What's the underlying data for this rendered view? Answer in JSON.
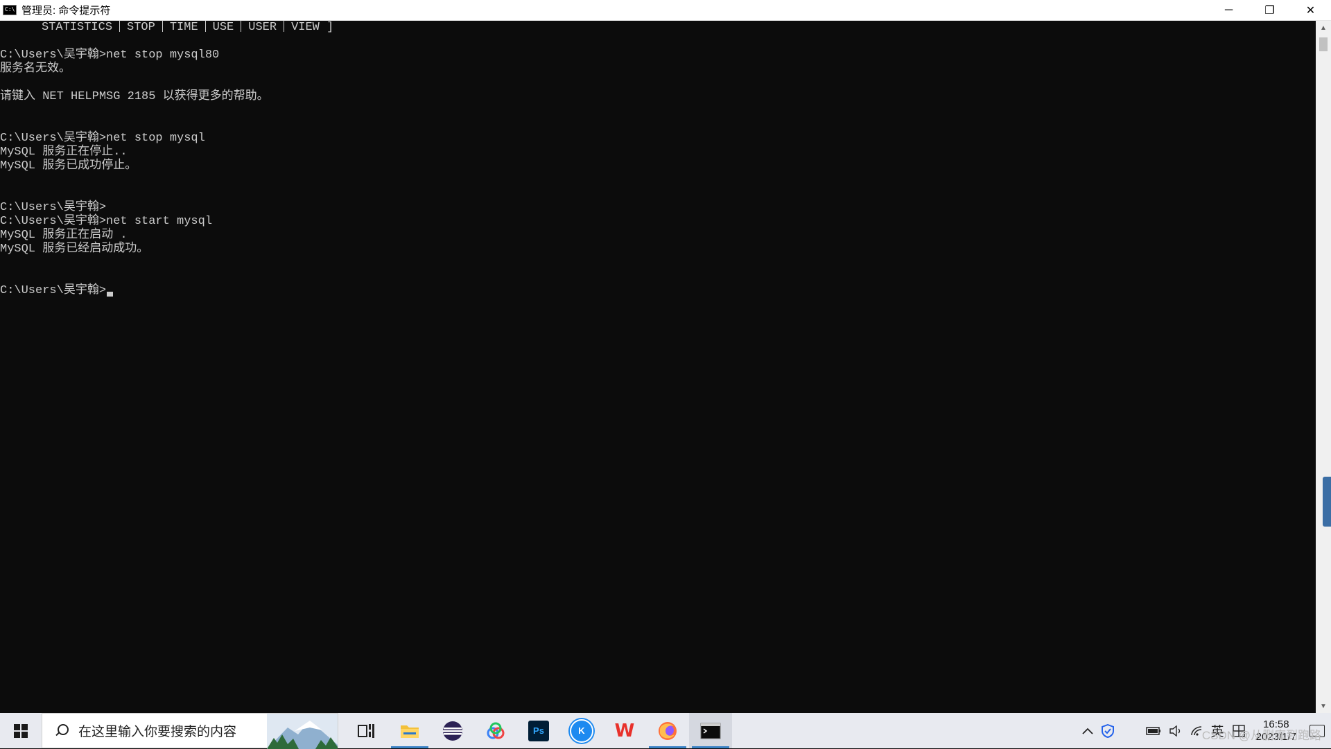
{
  "window": {
    "title": "管理员: 命令提示符",
    "controls": {
      "minimize": "─",
      "restore": "❐",
      "close": "✕"
    }
  },
  "console": {
    "header_items": [
      "STATISTICS",
      "STOP",
      "TIME",
      "USE",
      "USER",
      "VIEW ]"
    ],
    "lines": [
      "C:\\Users\\吴宇翰>net stop mysql80",
      "服务名无效。",
      "",
      "请键入 NET HELPMSG 2185 以获得更多的帮助。",
      "",
      "",
      "C:\\Users\\吴宇翰>net stop mysql",
      "MySQL 服务正在停止..",
      "MySQL 服务已成功停止。",
      "",
      "",
      "C:\\Users\\吴宇翰>",
      "C:\\Users\\吴宇翰>net start mysql",
      "MySQL 服务正在启动 .",
      "MySQL 服务已经启动成功。",
      "",
      "",
      "C:\\Users\\吴宇翰>"
    ]
  },
  "taskbar": {
    "search_placeholder": "在这里输入你要搜索的内容",
    "apps": [
      {
        "name": "task-view",
        "label": "",
        "color": "#222222"
      },
      {
        "name": "file-explorer",
        "label": "",
        "color": "#f3c13a"
      },
      {
        "name": "eclipse",
        "label": "",
        "color": "#2c2255"
      },
      {
        "name": "baidu-netdisk",
        "label": "",
        "color": "#3b82f6"
      },
      {
        "name": "photoshop",
        "label": "Ps",
        "color": "#001e36"
      },
      {
        "name": "kugou-music",
        "label": "K",
        "color": "#1d8af0"
      },
      {
        "name": "wps-office",
        "label": "W",
        "color": "#e8312b"
      },
      {
        "name": "firefox",
        "label": "",
        "color": "#ff7139"
      },
      {
        "name": "command-prompt",
        "label": "",
        "color": "#0c0c0c"
      }
    ],
    "tray": {
      "ime": "英",
      "time": "16:58",
      "date": "2023/1/7",
      "watermark": "CSDN @从删库到跑路"
    }
  },
  "colors": {
    "console_bg": "#0c0c0c",
    "console_text": "#cccccc",
    "taskbar_bg": "#e8eaf0",
    "active_indicator": "#3b82c4"
  }
}
